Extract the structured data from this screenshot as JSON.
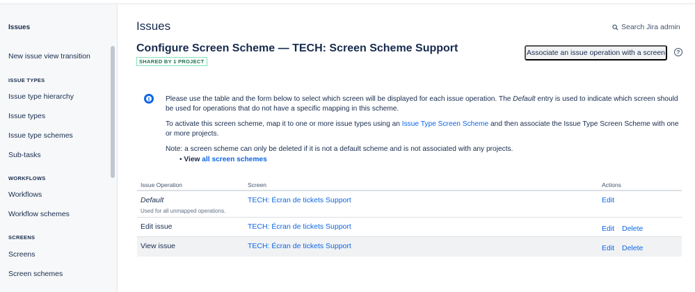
{
  "sidebar": {
    "title": "Issues",
    "items": [
      {
        "label": "New issue view transition"
      },
      {
        "label": "Issue type hierarchy"
      },
      {
        "label": "Issue types"
      },
      {
        "label": "Issue type schemes"
      },
      {
        "label": "Sub-tasks"
      },
      {
        "label": "Workflows"
      },
      {
        "label": "Workflow schemes"
      },
      {
        "label": "Screens"
      },
      {
        "label": "Screen schemes"
      }
    ],
    "headings": {
      "issue_types": "ISSUE TYPES",
      "workflows": "WORKFLOWS",
      "screens": "SCREENS"
    }
  },
  "header": {
    "title": "Issues",
    "search_label": "Search Jira admin"
  },
  "scheme": {
    "title": "Configure Screen Scheme — TECH: Screen Scheme Support",
    "badge": "SHARED BY 1 PROJECT",
    "associate_button": "Associate an issue operation with a screen"
  },
  "info": {
    "p1_before": "Please use the table and the form below to select which screen will be displayed for each issue operation. The ",
    "p1_em": "Default",
    "p1_after": " entry is used to indicate which screen should be used for operations that do not have a specific mapping in this scheme.",
    "p2_before": "To activate this screen scheme, map it to one or more issue types using an ",
    "p2_link": "Issue Type Screen Scheme",
    "p2_after": " and then associate the Issue Type Screen Scheme with one or more projects.",
    "p3": "Note: a screen scheme can only be deleted if it is not a default scheme and is not associated with any projects.",
    "bullet_label": "View",
    "bullet_link": "all screen schemes"
  },
  "table": {
    "headers": {
      "operation": "Issue Operation",
      "screen": "Screen",
      "actions": "Actions"
    },
    "rows": [
      {
        "operation": "Default",
        "note": "Used for all unmapped operations.",
        "screen": "TECH: Écran de tickets Support",
        "edit": "Edit"
      },
      {
        "operation": "Edit issue",
        "screen": "TECH: Écran de tickets Support",
        "edit": "Edit",
        "delete": "Delete"
      },
      {
        "operation": "View issue",
        "screen": "TECH: Écran de tickets Support",
        "edit": "Edit",
        "delete": "Delete"
      }
    ]
  },
  "colors": {
    "link": "#0c66e4",
    "text": "#172b4d",
    "badge": "#216e4e"
  }
}
